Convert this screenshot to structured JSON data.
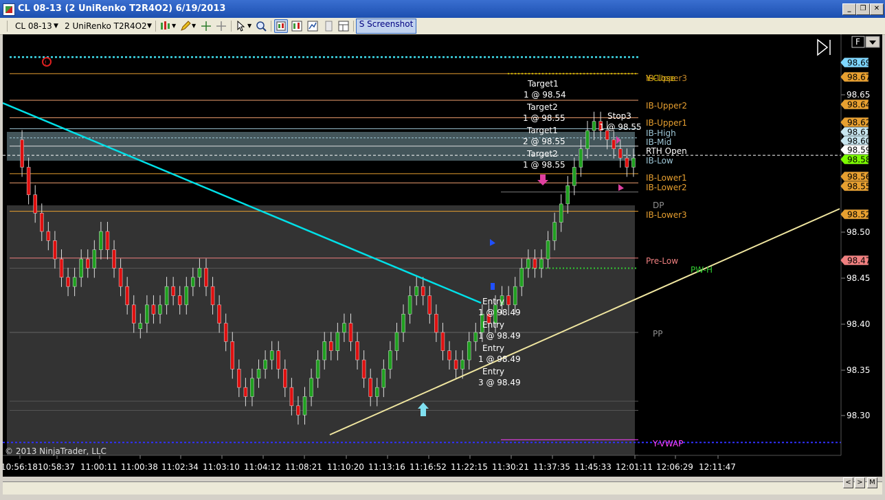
{
  "window": {
    "title": "CL 08-13 (2 UniRenko T2R4O2)  6/19/2013"
  },
  "toolbar": {
    "instrument": "CL 08-13",
    "bar_type": "2 UniRenko T2R4O2",
    "screenshot_label": "S Screenshot"
  },
  "chart": {
    "copyright": "© 2013 NinjaTrader, LLC",
    "fixed_label": "F",
    "price_ticks": [
      "98.65",
      "98.50",
      "98.45",
      "98.40",
      "98.35",
      "98.30"
    ],
    "time_ticks": [
      "10:56:18",
      "10:58:37",
      "11:00:11",
      "11:00:38",
      "11:02:34",
      "11:03:10",
      "11:04:12",
      "11:08:21",
      "11:10:20",
      "11:13:16",
      "11:16:52",
      "11:22:15",
      "11:30:21",
      "11:37:35",
      "11:45:33",
      "12:01:11",
      "12:06:29",
      "12:11:47"
    ],
    "price_flags": [
      {
        "price": "98.69",
        "color": "#7fd7ff"
      },
      {
        "price": "98.67",
        "color": "#e8a030"
      },
      {
        "price": "98.64",
        "color": "#e8a030"
      },
      {
        "price": "98.62",
        "color": "#e8a030"
      },
      {
        "price": "98.61",
        "color": "#c8e6f0"
      },
      {
        "price": "98.60",
        "color": "#c8e6f0"
      },
      {
        "price": "98.59",
        "color": "#ffffff"
      },
      {
        "price": "98.58",
        "color": "#7cfc00"
      },
      {
        "price": "98.56",
        "color": "#e8a030"
      },
      {
        "price": "98.55",
        "color": "#e8a030"
      },
      {
        "price": "98.52",
        "color": "#e8a030"
      },
      {
        "price": "98.47",
        "color": "#f08080"
      }
    ],
    "levels": [
      {
        "name": "Y-Close",
        "overlay": "IB-Upper3",
        "color": "#d4c000"
      },
      {
        "name": "IB-Upper2",
        "color": "#e8a030"
      },
      {
        "name": "IB-Upper1",
        "color": "#e8a030"
      },
      {
        "name": "IB-High",
        "color": "#9fc8d8"
      },
      {
        "name": "IB-Mid",
        "color": "#9fc8d8"
      },
      {
        "name": "RTH Open",
        "color": "#ffffff"
      },
      {
        "name": "IB-Low",
        "color": "#9fc8d8"
      },
      {
        "name": "IB-Lower1",
        "color": "#e8a030"
      },
      {
        "name": "IB-Lower2",
        "color": "#e8a030"
      },
      {
        "name": "DP",
        "color": "#909090"
      },
      {
        "name": "IB-Lower3",
        "color": "#e8a030"
      },
      {
        "name": "Pre-Low",
        "color": "#f08080"
      },
      {
        "name": "PW-H",
        "color": "#32cd32"
      },
      {
        "name": "PP",
        "color": "#909090"
      },
      {
        "name": "Y-VWAP",
        "color": "#ff40ff"
      }
    ],
    "orders": [
      {
        "label": "Target1",
        "detail": "1 @ 98.54"
      },
      {
        "label": "Target2",
        "detail": "1 @ 98.55"
      },
      {
        "label": "Target1",
        "detail": "2 @ 98.55"
      },
      {
        "label": "Target2",
        "detail": "1 @ 98.55"
      },
      {
        "label": "Stop3",
        "detail": "1 @ 98.55"
      },
      {
        "label": "Entry",
        "detail": "1 @ 98.49"
      },
      {
        "label": "Entry",
        "detail": "1 @ 98.49"
      },
      {
        "label": "Entry",
        "detail": "1 @ 98.49"
      },
      {
        "label": "Entry",
        "detail": "3 @ 98.49"
      }
    ]
  },
  "scroll": {
    "left": "<",
    "right": ">",
    "mode": "M"
  }
}
